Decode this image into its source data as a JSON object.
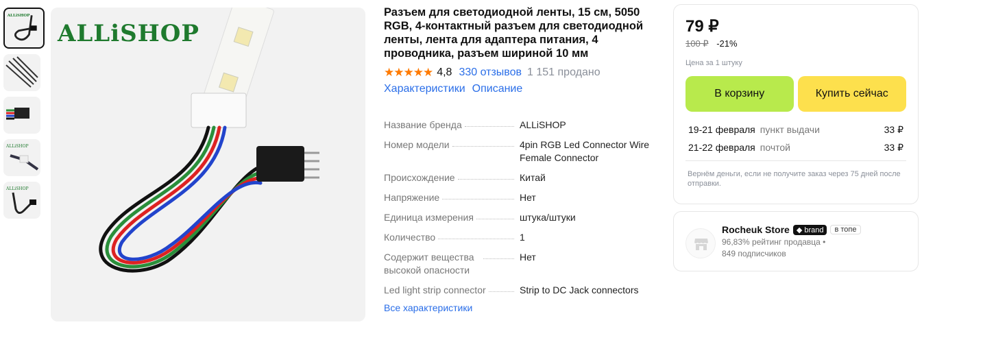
{
  "thumbnails": [
    {
      "name": "thumb-1"
    },
    {
      "name": "thumb-2"
    },
    {
      "name": "thumb-3"
    },
    {
      "name": "thumb-4"
    },
    {
      "name": "thumb-5"
    }
  ],
  "main_image": {
    "logo_text": "ALLiSHOP"
  },
  "product": {
    "title": "Разъем для светодиодной ленты, 15 см, 5050 RGB, 4-контактный разъем для светодиодной ленты, лента для адаптера питания, 4 проводника, разъем шириной 10 мм",
    "stars": "★★★★★",
    "rating": "4,8",
    "reviews": "330 отзывов",
    "sold": "1 151 продано",
    "tabs": [
      "Характеристики",
      "Описание"
    ]
  },
  "specs": [
    {
      "key": "Название бренда",
      "value": "ALLiSHOP"
    },
    {
      "key": "Номер модели",
      "value": "4pin RGB Led Connector Wire Female Connector"
    },
    {
      "key": "Происхождение",
      "value": "Китай"
    },
    {
      "key": "Напряжение",
      "value": "Нет"
    },
    {
      "key": "Единица измерения",
      "value": "штука/штуки"
    },
    {
      "key": "Количество",
      "value": "1"
    },
    {
      "key": "Содержит вещества высокой опасности",
      "value": "Нет"
    },
    {
      "key": "Led light strip connector",
      "value": "Strip to DC Jack connectors"
    }
  ],
  "all_specs_link": "Все характеристики",
  "price_card": {
    "price": "79 ₽",
    "old_price": "100 ₽",
    "discount": "-21%",
    "per_unit": "Цена за 1 штуку",
    "cart_button": "В корзину",
    "buy_button": "Купить сейчас",
    "delivery": [
      {
        "date": "19-21 февраля",
        "method": "пункт выдачи",
        "price": "33 ₽"
      },
      {
        "date": "21-22 февраля",
        "method": "почтой",
        "price": "33 ₽"
      }
    ],
    "refund_note": "Вернём деньги, если не получите заказ через 75 дней после отправки."
  },
  "seller": {
    "name": "Rocheuk Store",
    "brand_badge": "brand",
    "top_badge": "в топе",
    "rating": "96,83% рейтинг продавца",
    "followers": "849 подписчиков"
  },
  "colors": {
    "accent_link": "#2a6ee8",
    "cart_green": "#b8ea4c",
    "buy_yellow": "#fde04d",
    "star_orange": "#ff7a00"
  }
}
